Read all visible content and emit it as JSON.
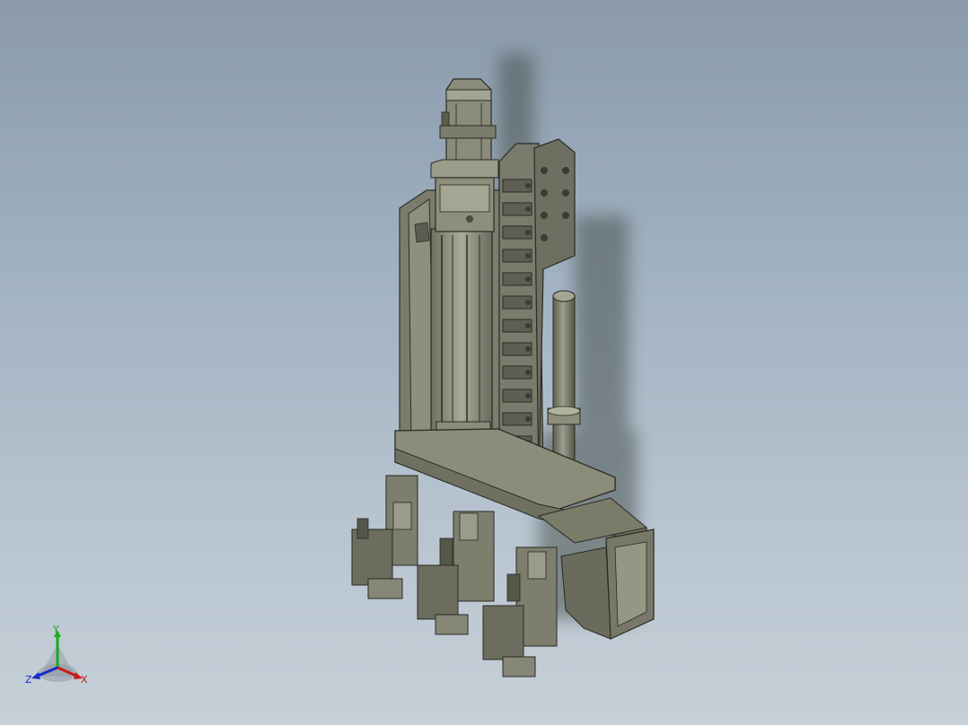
{
  "viewport": {
    "background_top": "#8a9aab",
    "background_bottom": "#c6d0d8",
    "model_color": "#7d7e6e",
    "model_shadow": "#5f6864"
  },
  "triad": {
    "y_label": "Y",
    "x_label": "X",
    "z_label": "Z",
    "y_color": "#1aaa1a",
    "x_color": "#cc1a1a",
    "z_color": "#1a2acc"
  }
}
